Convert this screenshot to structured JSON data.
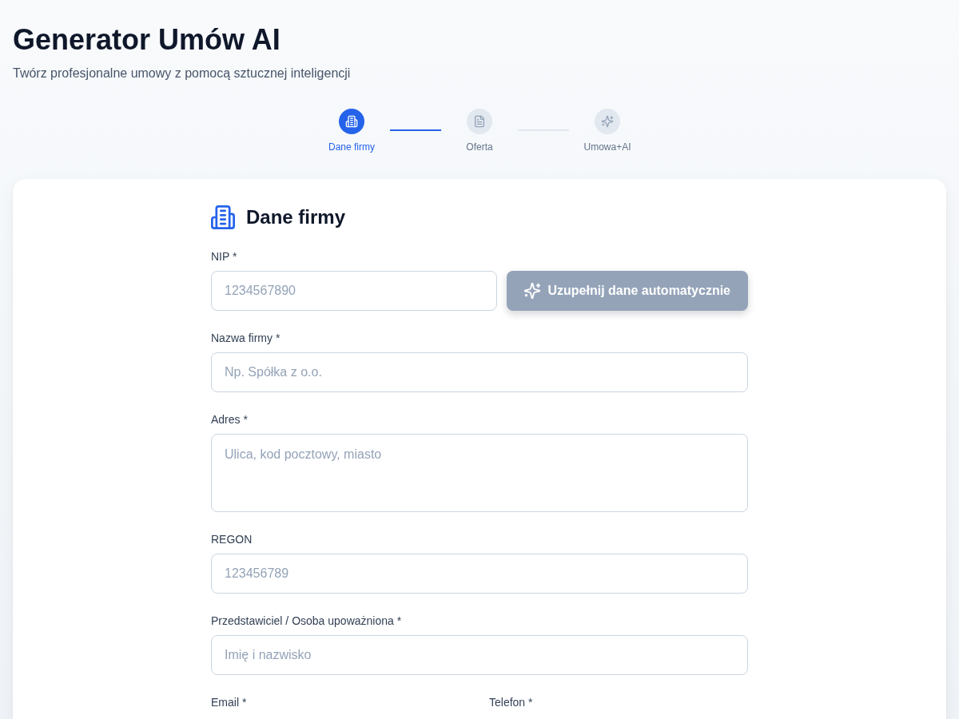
{
  "header": {
    "title": "Generator Umów AI",
    "subtitle": "Twórz profesjonalne umowy z pomocą sztucznej inteligencji"
  },
  "steps": [
    {
      "label": "Dane firmy",
      "selected": true
    },
    {
      "label": "Oferta",
      "selected": false
    },
    {
      "label": "Umowa+AI",
      "selected": false
    }
  ],
  "connectors": [
    {
      "filled": true
    },
    {
      "filled": false
    }
  ],
  "form": {
    "title": "Dane firmy",
    "rows": [
      {
        "kind": "input",
        "label": "NIP *",
        "placeholder": "1234567890",
        "button": {
          "label": "Uzupełnij dane automatycznie",
          "disabled": true
        }
      },
      {
        "kind": "input",
        "label": "Nazwa firmy *",
        "placeholder": "Np. Spółka z o.o."
      },
      {
        "kind": "textarea",
        "label": "Adres *",
        "placeholder": "Ulica, kod pocztowy, miasto"
      },
      {
        "kind": "input",
        "label": "REGON",
        "placeholder": "123456789"
      },
      {
        "kind": "input",
        "label": "Przedstawiciel / Osoba upoważniona *",
        "placeholder": "Imię i nazwisko"
      },
      {
        "kind": "pair",
        "columns": [
          {
            "label": "Email *"
          },
          {
            "label": "Telefon *"
          }
        ]
      }
    ]
  }
}
